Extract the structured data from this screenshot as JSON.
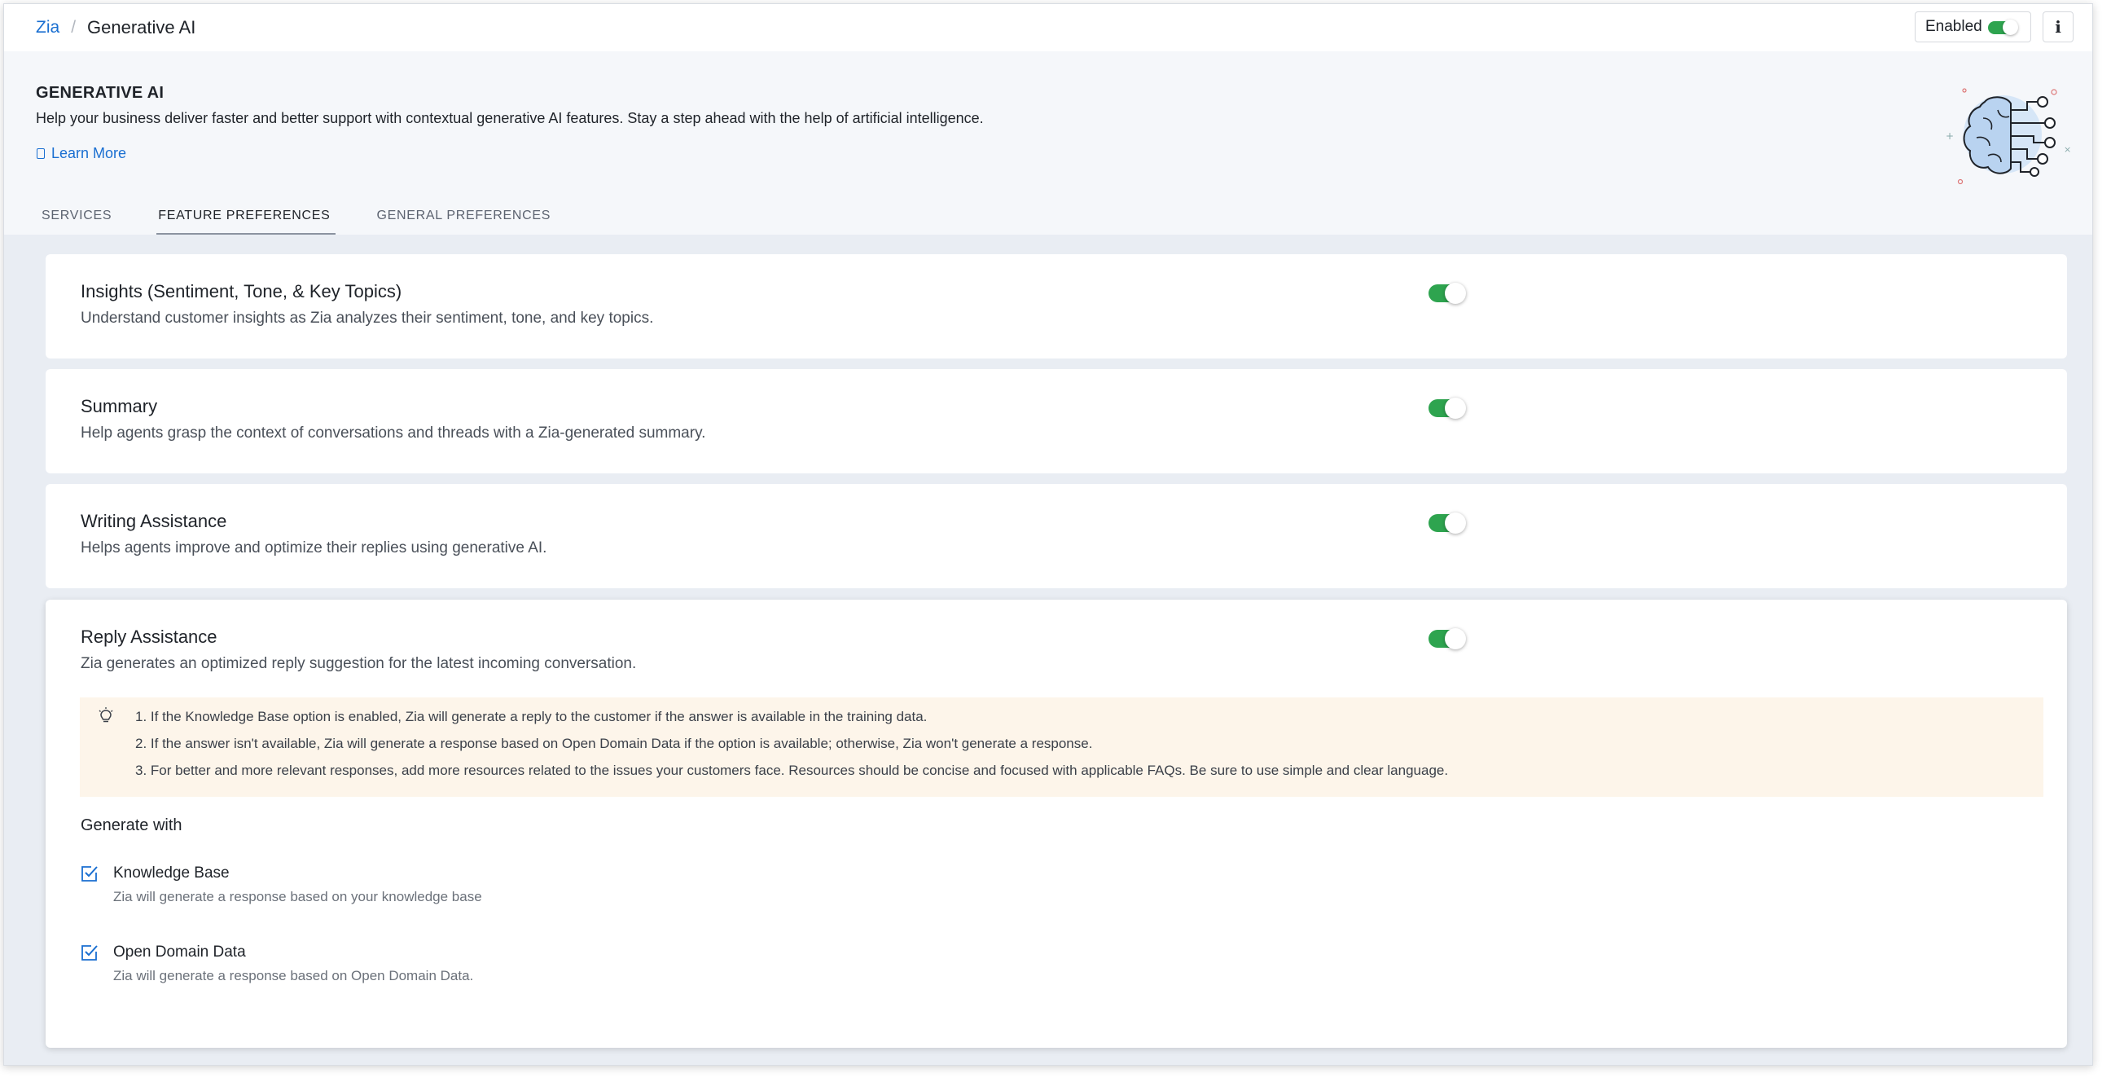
{
  "breadcrumb": {
    "parent": "Zia",
    "separator": "/",
    "current": "Generative AI"
  },
  "status": {
    "label": "Enabled",
    "enabled": true
  },
  "info_button": {
    "glyph": "i"
  },
  "header": {
    "title": "GENERATIVE AI",
    "description": "Help your business deliver faster and better support with contextual generative AI features. Stay a step ahead with the help of artificial intelligence.",
    "learn_more": "Learn More"
  },
  "tabs": [
    {
      "label": "SERVICES",
      "active": false
    },
    {
      "label": "FEATURE PREFERENCES",
      "active": true
    },
    {
      "label": "GENERAL PREFERENCES",
      "active": false
    }
  ],
  "features": [
    {
      "title": "Insights (Sentiment, Tone, & Key Topics)",
      "description": "Understand customer insights as Zia analyzes their sentiment, tone, and key topics.",
      "enabled": true
    },
    {
      "title": "Summary",
      "description": "Help agents grasp the context of conversations and threads with a Zia-generated summary.",
      "enabled": true
    },
    {
      "title": "Writing Assistance",
      "description": "Helps agents improve and optimize their replies using generative AI.",
      "enabled": true
    },
    {
      "title": "Reply Assistance",
      "description": "Zia generates an optimized reply suggestion for the latest incoming conversation.",
      "enabled": true,
      "notes": [
        "1. If the Knowledge Base option is enabled, Zia will generate a reply to the customer if the answer is available in the training data.",
        "2. If the answer isn't available, Zia will generate a response based on Open Domain Data if the option is available; otherwise, Zia won't generate a response.",
        "3. For better and more relevant responses, add more resources related to the issues your customers face. Resources should be concise and focused with applicable FAQs. Be sure to use simple and clear language."
      ],
      "generate_with": {
        "title": "Generate with",
        "options": [
          {
            "label": "Knowledge Base",
            "description": "Zia will generate a response based on your knowledge base",
            "checked": true
          },
          {
            "label": "Open Domain Data",
            "description": "Zia will generate a response based on Open Domain Data.",
            "checked": true
          }
        ]
      }
    }
  ],
  "colors": {
    "accent": "#1a6fd1",
    "toggle_on": "#2ea44f",
    "note_bg": "#fdf5ea",
    "page_bg": "#e9edf3"
  }
}
